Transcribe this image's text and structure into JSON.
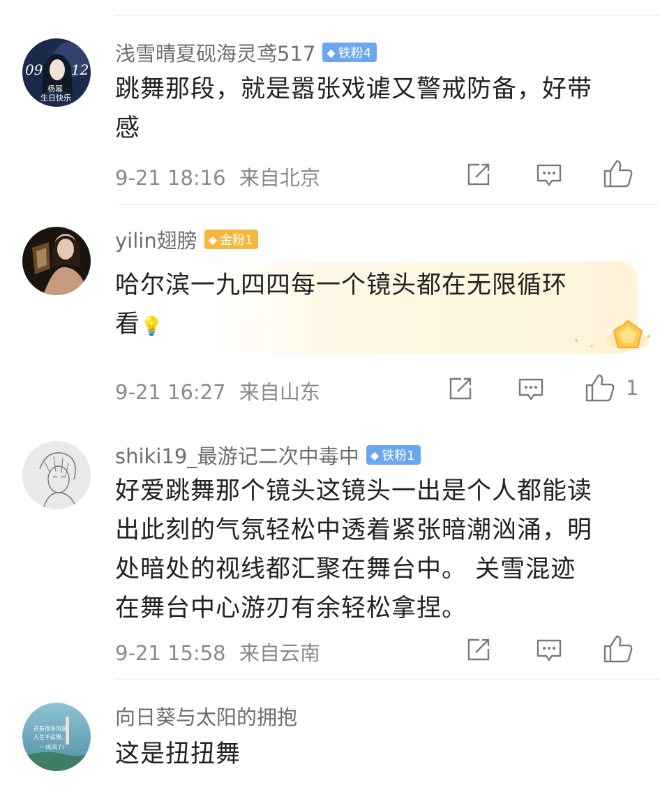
{
  "comments": [
    {
      "username": "浅雪晴夏砚海灵鸢517",
      "badge": "铁粉4",
      "badge_type": "iron",
      "avatar_text_line1": "09",
      "avatar_text_line2": "12",
      "avatar_text_line3": "杨幂",
      "avatar_text_line4": "生日快乐",
      "text_line1": "跳舞那段，就是嚣张戏谑又警戒防备，好带",
      "text_line2": "感",
      "time": "9-21 18:16",
      "location": "来自北京",
      "like_count": ""
    },
    {
      "username": "yilin翅膀",
      "badge": "金粉1",
      "badge_type": "gold",
      "text_line1": "哈尔滨一九四四每一个镜头都在无限循环",
      "text_line2": "看",
      "emoji": "💡",
      "time": "9-21 16:27",
      "location": "来自山东",
      "like_count": "1"
    },
    {
      "username": "shiki19_最游记二次中毒中",
      "badge": "铁粉1",
      "badge_type": "iron",
      "text_line1": "好爱跳舞那个镜头这镜头一出是个人都能读",
      "text_line2": "出此刻的气氛轻松中透着紧张暗潮汹涌，明",
      "text_line3": "处暗处的视线都汇聚在舞台中。 关雪混迹",
      "text_line4": "在舞台中心游刃有余轻松拿捏。",
      "time": "9-21 15:58",
      "location": "来自云南",
      "like_count": ""
    },
    {
      "username": "向日葵与太阳的拥抱",
      "avatar_text_line1": "还有很多风景",
      "avatar_text_line2": "人生不设限。",
      "avatar_text_line3": "一 (起风了)",
      "text_line1": "这是扭扭舞"
    }
  ],
  "icons": {
    "share": "share-icon",
    "comment": "comment-icon",
    "like": "thumbs-up-icon",
    "badge_gem": "diamond-icon"
  },
  "colors": {
    "iron_badge": "#6aa7f0",
    "gold_badge": "#f6b73c",
    "username": "#6e6e6e",
    "meta": "#8a8a8a"
  }
}
